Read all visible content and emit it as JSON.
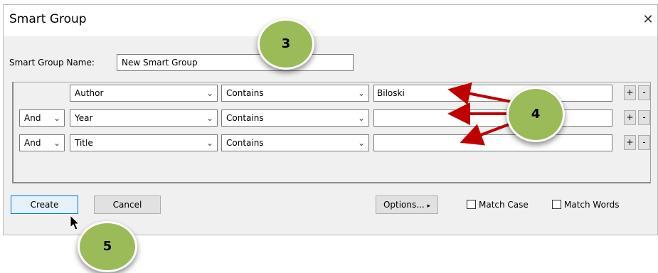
{
  "dialog": {
    "title": "Smart Group",
    "close_glyph": "✕",
    "name_label": "Smart Group Name:",
    "name_value": "New Smart Group"
  },
  "rows": [
    {
      "connector": "",
      "field": "Author",
      "operator": "Contains",
      "value": "Biloski"
    },
    {
      "connector": "And",
      "field": "Year",
      "operator": "Contains",
      "value": ""
    },
    {
      "connector": "And",
      "field": "Title",
      "operator": "Contains",
      "value": ""
    }
  ],
  "row_buttons": {
    "add": "+",
    "remove": "-"
  },
  "buttons": {
    "create": "Create",
    "cancel": "Cancel",
    "options": "Options...",
    "options_arrow": "▸"
  },
  "checkboxes": {
    "match_case": "Match Case",
    "match_words": "Match Words"
  },
  "callouts": {
    "three": "3",
    "four": "4",
    "five": "5"
  },
  "icons": {
    "chevron": "chevron-down-icon",
    "close": "close-icon",
    "cursor": "mouse-pointer-icon"
  },
  "colors": {
    "badge": "#9bbb59",
    "arrow": "#c00000",
    "default_button_border": "#0078d7"
  }
}
